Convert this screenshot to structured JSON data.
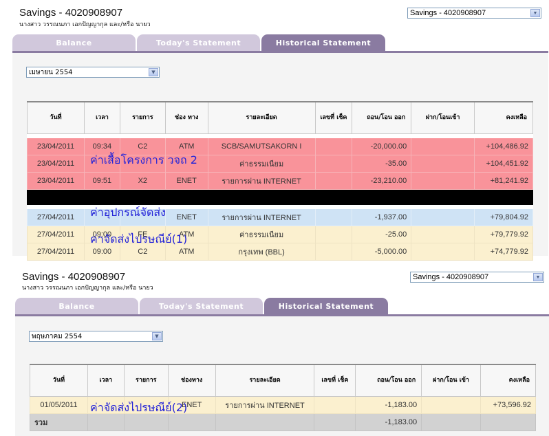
{
  "panel1": {
    "account_title": "Savings - 4020908907",
    "account_owner": "นางสาว วรรณนภา เอกปัญญากุล และ/หรือ นายว",
    "account_select": "Savings - 4020908907",
    "tabs": {
      "balance": "Balance",
      "today": "Today's Statement",
      "historical": "Historical Statement"
    },
    "month": "เมษายน 2554",
    "headers": {
      "date": "วันที่",
      "time": "เวลา",
      "type": "รายการ",
      "channel": "ช่อง ทาง",
      "detail": "รายละเอียด",
      "cheque": "เลขที่ เช็ค",
      "withdraw": "ถอน/โอน ออก",
      "deposit": "ฝาก/โอนเข้า",
      "balance": "คงเหลือ"
    },
    "rows": [
      {
        "date": "23/04/2011",
        "time": "09:34",
        "type": "C2",
        "channel": "ATM",
        "detail": "SCB/SAMUTSAKORN I",
        "cheque": "",
        "withdraw": "-20,000.00",
        "deposit": "",
        "balance": "+104,486.92"
      },
      {
        "date": "23/04/2011",
        "time": "",
        "type": "",
        "channel": "",
        "detail": "ค่าธรรมเนียม",
        "cheque": "",
        "withdraw": "-35.00",
        "deposit": "",
        "balance": "+104,451.92"
      },
      {
        "date": "23/04/2011",
        "time": "09:51",
        "type": "X2",
        "channel": "ENET",
        "detail": "รายการผ่าน INTERNET",
        "cheque": "",
        "withdraw": "-23,210.00",
        "deposit": "",
        "balance": "+81,241.92"
      },
      {
        "date": "27/04/2011",
        "time": "",
        "type": "",
        "channel": "ENET",
        "detail": "รายการผ่าน INTERNET",
        "cheque": "",
        "withdraw": "-1,937.00",
        "deposit": "",
        "balance": "+79,804.92"
      },
      {
        "date": "27/04/2011",
        "time": "09:00",
        "type": "FE",
        "channel": "ATM",
        "detail": "ค่าธรรมเนียม",
        "cheque": "",
        "withdraw": "-25.00",
        "deposit": "",
        "balance": "+79,779.92"
      },
      {
        "date": "27/04/2011",
        "time": "09:00",
        "type": "C2",
        "channel": "ATM",
        "detail": "กรุงเทพ (BBL)",
        "cheque": "",
        "withdraw": "-5,000.00",
        "deposit": "",
        "balance": "+74,779.92"
      }
    ],
    "annotations": {
      "a1": "ค่าเสื้อโครงการ วจถ 2",
      "a2": "ค่าอุปกรณ์จัดส่ง",
      "a3": "ค่าจัดส่งไปรษณีย์(1)"
    }
  },
  "panel2": {
    "account_title": "Savings - 4020908907",
    "account_owner": "นางสาว วรรณนภา เอกปัญญากุล และ/หรือ นายว",
    "account_select": "Savings - 4020908907",
    "tabs": {
      "balance": "Balance",
      "today": "Today's Statement",
      "historical": "Historical Statement"
    },
    "month": "พฤษภาคม 2554",
    "headers": {
      "date": "วันที่",
      "time": "เวลา",
      "type": "รายการ",
      "channel": "ช่องทาง",
      "detail": "รายละเอียด",
      "cheque": "เลขที่ เช็ค",
      "withdraw": "ถอน/โอน ออก",
      "deposit": "ฝาก/โอน เข้า",
      "balance": "คงเหลือ"
    },
    "rows": [
      {
        "date": "01/05/2011",
        "time": "",
        "type": "",
        "channel": "ENET",
        "detail": "รายการผ่าน INTERNET",
        "cheque": "",
        "withdraw": "-1,183.00",
        "deposit": "",
        "balance": "+73,596.92"
      }
    ],
    "total": {
      "label": "รวม",
      "withdraw": "-1,183.00"
    },
    "annotations": {
      "a1": "ค่าจัดส่งไปรษณีย์(2)"
    }
  },
  "colors": {
    "tab_active": "#8a7ba1",
    "tab_inactive": "#d1c8dc",
    "row_red": "#f9939a",
    "row_blue": "#cfe3f5",
    "row_yellow": "#fbf0cf",
    "annotation": "#2323d8"
  }
}
